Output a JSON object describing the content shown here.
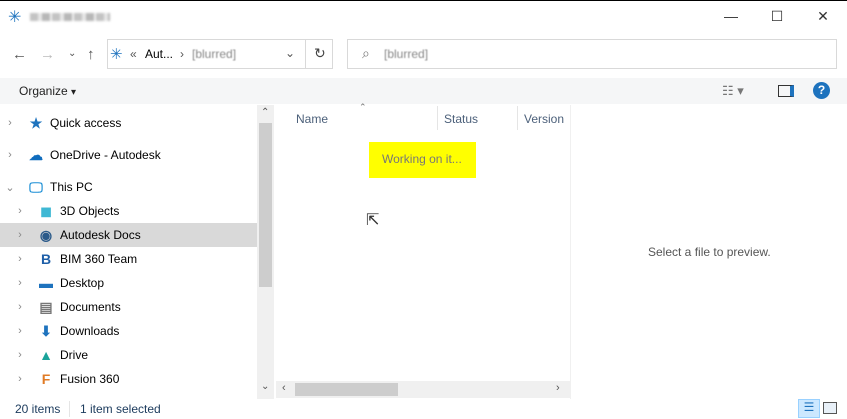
{
  "window": {
    "title": "[blurred]",
    "minimize": "—",
    "maximize": "☐",
    "close": "✕"
  },
  "nav": {
    "back": "←",
    "forward": "→",
    "recent": "⌄",
    "up": "↑",
    "refresh": "↻"
  },
  "address": {
    "prefix": "«",
    "crumbs": [
      "Aut...",
      "[blurred]"
    ],
    "sep": "›",
    "dropdown": "⌄"
  },
  "search": {
    "placeholder": "[blurred]"
  },
  "toolbar": {
    "organize": "Organize",
    "caret": "▾",
    "help": "?"
  },
  "tree": [
    {
      "label": "Quick access",
      "icon": "star-icon",
      "expanded": false,
      "indent": 0
    },
    {
      "label": "OneDrive - Autodesk",
      "icon": "cloud-icon",
      "expanded": false,
      "indent": 0
    },
    {
      "label": "This PC",
      "icon": "computer-icon",
      "expanded": true,
      "indent": 0
    },
    {
      "label": "3D Objects",
      "icon": "cube-icon",
      "expanded": false,
      "indent": 1
    },
    {
      "label": "Autodesk Docs",
      "icon": "globe-icon",
      "expanded": false,
      "indent": 1,
      "selected": true
    },
    {
      "label": "BIM 360 Team",
      "icon": "bim-icon",
      "expanded": false,
      "indent": 1
    },
    {
      "label": "Desktop",
      "icon": "desktop-icon",
      "expanded": false,
      "indent": 1
    },
    {
      "label": "Documents",
      "icon": "document-icon",
      "expanded": false,
      "indent": 1
    },
    {
      "label": "Downloads",
      "icon": "download-icon",
      "expanded": false,
      "indent": 1
    },
    {
      "label": "Drive",
      "icon": "drive-icon",
      "expanded": false,
      "indent": 1
    },
    {
      "label": "Fusion 360",
      "icon": "fusion-icon",
      "expanded": false,
      "indent": 1
    }
  ],
  "columns": [
    "Name",
    "Status",
    "Version"
  ],
  "content": {
    "working": "Working on it..."
  },
  "preview": {
    "message": "Select a file to preview."
  },
  "status": {
    "count": "20 items",
    "selected": "1 item selected"
  },
  "colors": {
    "highlight": "#ffff00",
    "selection": "#d9d9d9",
    "accent": "#1e73be"
  }
}
